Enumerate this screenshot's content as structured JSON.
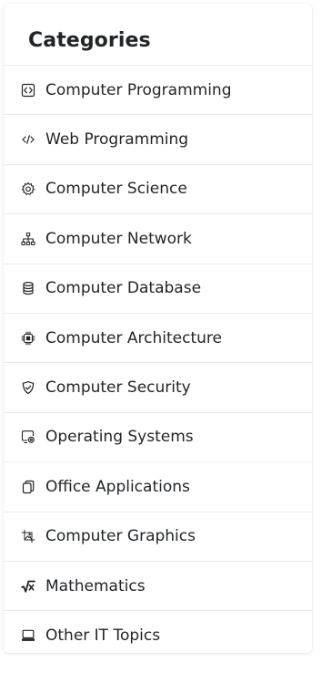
{
  "panel": {
    "title": "Categories",
    "items": [
      {
        "label": "Computer Programming",
        "icon": "code-square-icon"
      },
      {
        "label": "Web Programming",
        "icon": "code-slash-icon"
      },
      {
        "label": "Computer Science",
        "icon": "gear-icon"
      },
      {
        "label": "Computer Network",
        "icon": "network-icon"
      },
      {
        "label": "Computer Database",
        "icon": "database-icon"
      },
      {
        "label": "Computer Architecture",
        "icon": "cpu-icon"
      },
      {
        "label": "Computer Security",
        "icon": "shield-check-icon"
      },
      {
        "label": "Operating Systems",
        "icon": "pc-gear-icon"
      },
      {
        "label": "Office Applications",
        "icon": "documents-icon"
      },
      {
        "label": "Computer Graphics",
        "icon": "image-edit-icon"
      },
      {
        "label": "Mathematics",
        "icon": "square-root-icon"
      },
      {
        "label": "Other IT Topics",
        "icon": "laptop-icon"
      }
    ]
  },
  "colors": {
    "text": "#212529",
    "divider": "#e9ecef",
    "background": "#ffffff"
  }
}
